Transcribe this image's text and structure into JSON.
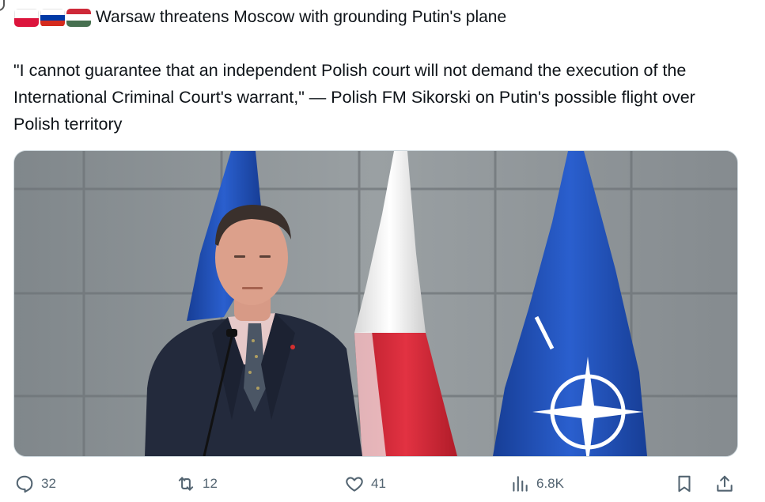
{
  "post": {
    "flags": [
      {
        "name": "poland-flag",
        "colors": [
          "#ffffff",
          "#dc143c"
        ]
      },
      {
        "name": "russia-flag",
        "colors": [
          "#ffffff",
          "#0039a6",
          "#d52b1e"
        ]
      },
      {
        "name": "hungary-flag",
        "colors": [
          "#ce2939",
          "#ffffff",
          "#477050"
        ]
      }
    ],
    "headline": "Warsaw threatens Moscow with grounding Putin's plane",
    "quote": "\"I cannot guarantee that an independent Polish court will not demand the execution of the International Criminal Court's warrant,\" — Polish FM Sikorski on Putin's possible flight over Polish territory"
  },
  "actions": {
    "replies": "32",
    "reposts": "12",
    "likes": "41",
    "views": "6.8K"
  },
  "colors": {
    "text": "#0f1419",
    "muted": "#536471",
    "nato_blue": "#1f4fb4",
    "polish_red": "#d92b3a"
  }
}
